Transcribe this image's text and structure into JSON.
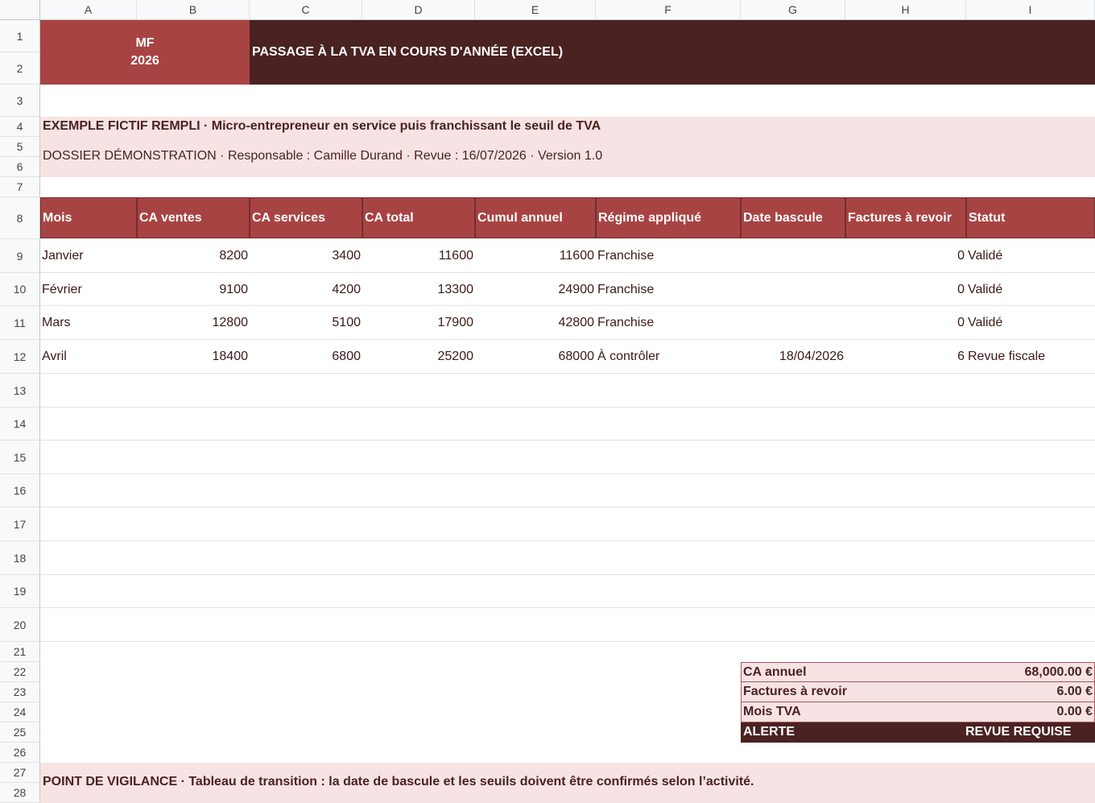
{
  "columns": [
    "A",
    "B",
    "C",
    "D",
    "E",
    "F",
    "G",
    "H",
    "I"
  ],
  "rows": [
    "1",
    "2",
    "3",
    "4",
    "5",
    "6",
    "7",
    "8",
    "9",
    "10",
    "11",
    "12",
    "13",
    "14",
    "15",
    "16",
    "17",
    "18",
    "19",
    "20",
    "21",
    "22",
    "23",
    "24",
    "25",
    "26",
    "27",
    "28"
  ],
  "banner": {
    "code": "MF",
    "year": "2026",
    "title": "PASSAGE À LA TVA EN COURS D'ANNÉE (EXCEL)"
  },
  "info": {
    "example_line": "EXEMPLE FICTIF REMPLI · Micro-entrepreneur en service puis franchissant le seuil de TVA",
    "dossier_line": "DOSSIER DÉMONSTRATION · Responsable : Camille Durand · Revue : 16/07/2026 · Version 1.0"
  },
  "table": {
    "headers": [
      "Mois",
      "CA ventes",
      "CA services",
      "CA total",
      "Cumul annuel",
      "Régime appliqué",
      "Date bascule",
      "Factures à revoir",
      "Statut"
    ],
    "rows": [
      [
        "Janvier",
        "8200",
        "3400",
        "11600",
        "11600",
        "Franchise",
        "",
        "0",
        "Validé"
      ],
      [
        "Février",
        "9100",
        "4200",
        "13300",
        "24900",
        "Franchise",
        "",
        "0",
        "Validé"
      ],
      [
        "Mars",
        "12800",
        "5100",
        "17900",
        "42800",
        "Franchise",
        "",
        "0",
        "Validé"
      ],
      [
        "Avril",
        "18400",
        "6800",
        "25200",
        "68000",
        "À contrôler",
        "18/04/2026",
        "6",
        "Revue fiscale"
      ]
    ]
  },
  "summary": {
    "ca_label": "CA annuel",
    "ca_value": "68,000.00 €",
    "factures_label": "Factures à revoir",
    "factures_value": "6.00 €",
    "mois_label": "Mois TVA",
    "mois_value": "0.00 €",
    "alert_label": "ALERTE",
    "alert_value": "REVUE REQUISE"
  },
  "footer": {
    "note": "POINT DE VIGILANCE · Tableau de transition : la date de bascule et les seuils doivent être confirmés selon l’activité."
  },
  "colors": {
    "accent_red": "#a84343",
    "dark_brown": "#4a2222",
    "pink_band": "#f7e3e3"
  }
}
